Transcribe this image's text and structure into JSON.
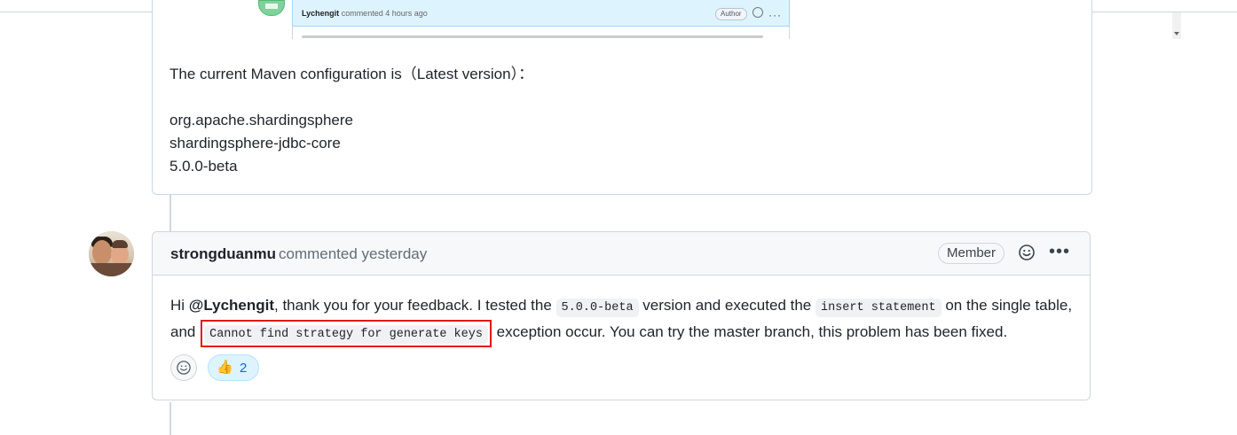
{
  "embedded_comment": {
    "author": "Lychengit",
    "meta": "commented 4 hours ago",
    "badge": "Author"
  },
  "upper_comment": {
    "line1": "The current Maven configuration is（Latest version）：",
    "maven_group": "org.apache.shardingsphere",
    "maven_artifact": "shardingsphere-jdbc-core",
    "maven_version": "5.0.0-beta"
  },
  "comment": {
    "author": "strongduanmu",
    "meta": "commented yesterday",
    "badge": "Member",
    "body": {
      "p1": "Hi ",
      "mention": "@Lychengit",
      "p2": ", thank you for your feedback. I tested the ",
      "code1": "5.0.0-beta",
      "p3": " version and executed the ",
      "code2": "insert statement",
      "p4": " on the single table, and ",
      "code3": "Cannot find strategy for generate keys",
      "p5": " exception occur. You can try the master branch, this problem has been fixed."
    },
    "reactions": [
      {
        "icon": "thumbs-up-icon",
        "emoji": "👍",
        "count": "2"
      }
    ]
  },
  "colors": {
    "highlight_border": "#e0161b",
    "link_blue": "#0969da",
    "reaction_bg": "#ddf4ff"
  }
}
